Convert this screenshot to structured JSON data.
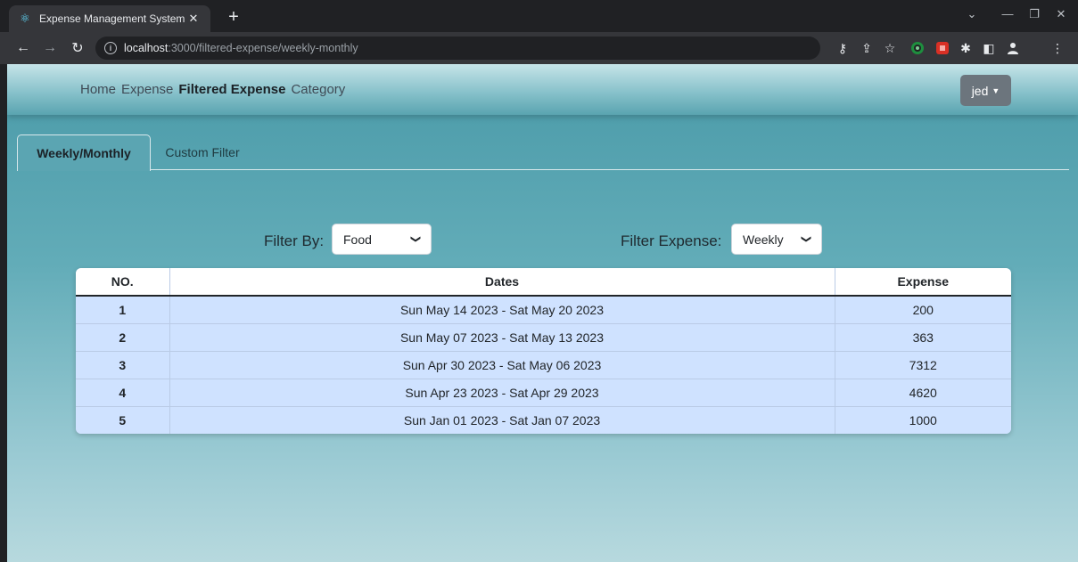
{
  "browser": {
    "tab_title": "Expense Management System",
    "url_host": "localhost",
    "url_path": ":3000/filtered-expense/weekly-monthly"
  },
  "navbar": {
    "links": [
      "Home",
      "Expense",
      "Filtered Expense",
      "Category"
    ],
    "active": "Filtered Expense",
    "user": "jed"
  },
  "tabs": [
    "Weekly/Monthly",
    "Custom Filter"
  ],
  "filters": {
    "filter_by_label": "Filter By:",
    "filter_by_value": "Food",
    "filter_expense_label": "Filter Expense:",
    "filter_expense_value": "Weekly"
  },
  "table": {
    "headers": [
      "NO.",
      "Dates",
      "Expense"
    ],
    "rows": [
      [
        "1",
        "Sun May 14 2023 - Sat May 20 2023",
        "200"
      ],
      [
        "2",
        "Sun May 07 2023 - Sat May 13 2023",
        "363"
      ],
      [
        "3",
        "Sun Apr 30 2023 - Sat May 06 2023",
        "7312"
      ],
      [
        "4",
        "Sun Apr 23 2023 - Sat Apr 29 2023",
        "4620"
      ],
      [
        "5",
        "Sun Jan 01 2023 - Sat Jan 07 2023",
        "1000"
      ]
    ]
  },
  "colors": {
    "accent": "#5ba5b2",
    "table_row": "#cfe2ff",
    "user_button": "#6c757d"
  },
  "icons": {
    "favicon": "react-icon",
    "new_tab": "plus-icon",
    "back": "arrow-left-icon",
    "forward": "arrow-right-icon",
    "reload": "reload-icon",
    "site_info": "info-icon",
    "key": "key-icon",
    "share": "share-icon",
    "bookmark": "star-icon",
    "extensions": "puzzle-icon",
    "side_panel": "side-panel-icon",
    "profile": "person-icon",
    "menu": "kebab-menu-icon"
  }
}
